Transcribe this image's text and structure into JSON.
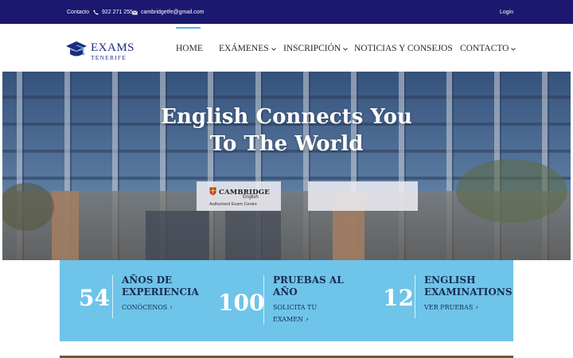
{
  "topbar": {
    "contact_label": "Contacto",
    "phone": "922 271 255",
    "email": "cambridgetfe@gmail.com",
    "login_label": "Login"
  },
  "logo": {
    "line1": "EXAMS",
    "line2": "TENERIFE"
  },
  "nav": {
    "items": [
      {
        "label": "HOME",
        "active": true,
        "has_dropdown": false
      },
      {
        "label": "EXÁMENES",
        "active": false,
        "has_dropdown": true
      },
      {
        "label": "INSCRIPCIÓN",
        "active": false,
        "has_dropdown": true
      },
      {
        "label": "NOTICIAS Y CONSEJOS",
        "active": false,
        "has_dropdown": false
      },
      {
        "label": "CONTACTO",
        "active": false,
        "has_dropdown": true
      }
    ],
    "accent_color": "#5bb3e3"
  },
  "hero": {
    "title_line1": "English Connects You",
    "title_line2": "To The World",
    "badge": {
      "brand": "CAMBRIDGE",
      "sub": "English",
      "caption": "Authorised Exam Centre"
    }
  },
  "stats": {
    "background_color": "#6ec4e9",
    "items": [
      {
        "number": "54",
        "title_line1": "AÑOS DE",
        "title_line2": "EXPERIENCIA",
        "link_line1": "CONÓCENOS",
        "link_line2": ""
      },
      {
        "number": "100",
        "title_line1": "PRUEBAS AL",
        "title_line2": "AÑO",
        "link_line1": "SOLICITA TU",
        "link_line2": "EXAMEN"
      },
      {
        "number": "12",
        "title_line1": "ENGLISH",
        "title_line2": "EXAMINATIONS",
        "link_line1": "VER PRUEBAS",
        "link_line2": ""
      }
    ]
  },
  "colors": {
    "topbar": "#1c1870",
    "brand_blue": "#1f2a80"
  }
}
